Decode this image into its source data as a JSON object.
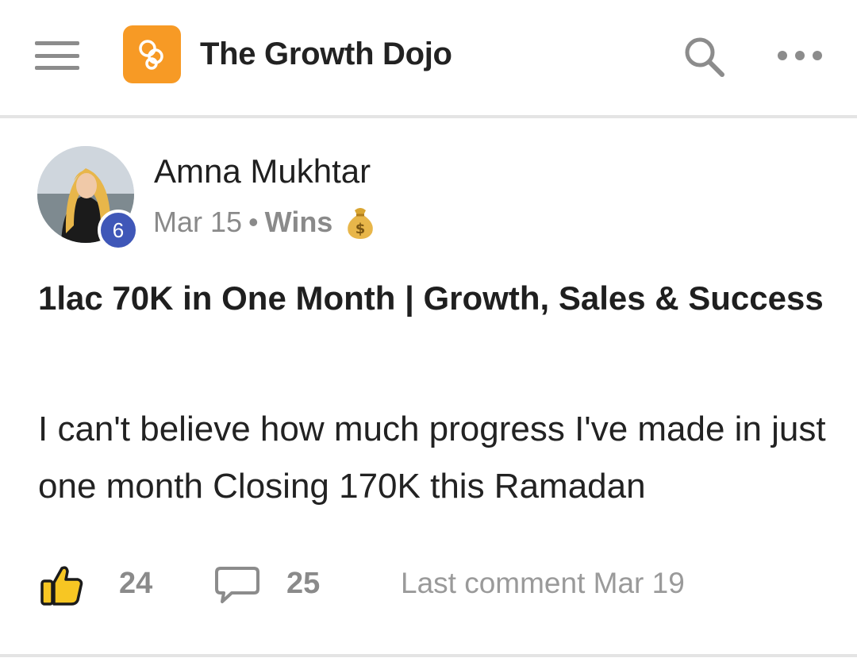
{
  "header": {
    "app_title": "The Growth Dojo",
    "logo_color": "#f79a25",
    "icons": [
      "menu-icon",
      "search-icon",
      "more-icon"
    ]
  },
  "post": {
    "author": {
      "name": "Amna Mukhtar",
      "level": "6",
      "level_badge_color": "#3f57b8"
    },
    "date": "Mar 15",
    "separator": "•",
    "category": "Wins",
    "category_icon": "money-bag-icon",
    "title": "1lac 70K in One Month | Growth, Sales & Success",
    "body": "I can't believe how much progress I've made in just one month Closing 170K this Ramadan",
    "likes": "24",
    "comments": "25",
    "last_comment": "Last comment Mar 19"
  }
}
